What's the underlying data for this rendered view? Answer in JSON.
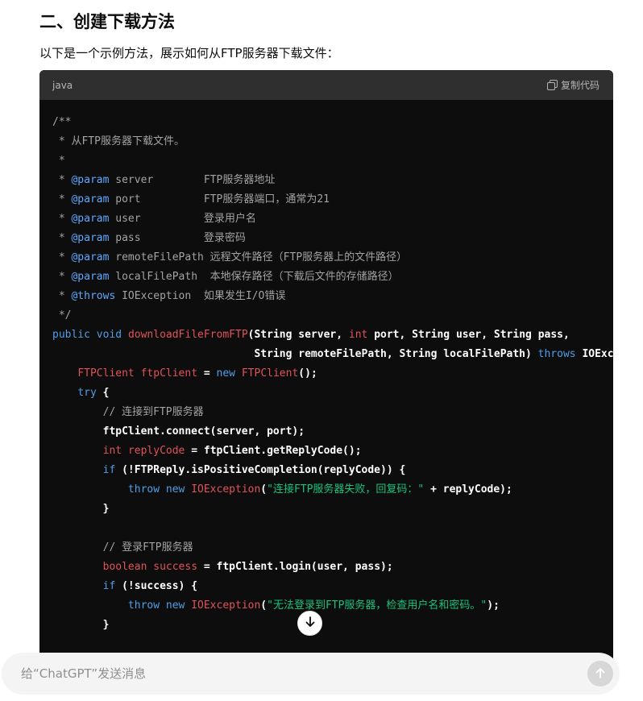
{
  "content": {
    "heading": "二、创建下载方法",
    "intro": "以下是一个示例方法，展示如何从FTP服务器下载文件："
  },
  "code_block": {
    "language": "java",
    "copy_label": "复制代码",
    "lines": [
      [
        {
          "t": "/**",
          "c": "comment"
        }
      ],
      [
        {
          "t": " * 从FTP服务器下载文件。",
          "c": "comment"
        }
      ],
      [
        {
          "t": " *",
          "c": "comment"
        }
      ],
      [
        {
          "t": " * ",
          "c": "comment"
        },
        {
          "t": "@param",
          "c": "tag"
        },
        {
          "t": " server        FTP服务器地址",
          "c": "comment"
        }
      ],
      [
        {
          "t": " * ",
          "c": "comment"
        },
        {
          "t": "@param",
          "c": "tag"
        },
        {
          "t": " port          FTP服务器端口，通常为21",
          "c": "comment"
        }
      ],
      [
        {
          "t": " * ",
          "c": "comment"
        },
        {
          "t": "@param",
          "c": "tag"
        },
        {
          "t": " user          登录用户名",
          "c": "comment"
        }
      ],
      [
        {
          "t": " * ",
          "c": "comment"
        },
        {
          "t": "@param",
          "c": "tag"
        },
        {
          "t": " pass          登录密码",
          "c": "comment"
        }
      ],
      [
        {
          "t": " * ",
          "c": "comment"
        },
        {
          "t": "@param",
          "c": "tag"
        },
        {
          "t": " remoteFilePath 远程文件路径（FTP服务器上的文件路径）",
          "c": "comment"
        }
      ],
      [
        {
          "t": " * ",
          "c": "comment"
        },
        {
          "t": "@param",
          "c": "tag"
        },
        {
          "t": " localFilePath  本地保存路径（下载后文件的存储路径）",
          "c": "comment"
        }
      ],
      [
        {
          "t": " * ",
          "c": "comment"
        },
        {
          "t": "@throws",
          "c": "tag"
        },
        {
          "t": " IOException  如果发生I/O错误",
          "c": "comment"
        }
      ],
      [
        {
          "t": " */",
          "c": "comment"
        }
      ],
      [
        {
          "t": "public",
          "c": "keyword"
        },
        {
          "t": " ",
          "c": "plain"
        },
        {
          "t": "void",
          "c": "keyword"
        },
        {
          "t": " ",
          "c": "plain"
        },
        {
          "t": "downloadFileFromFTP",
          "c": "func"
        },
        {
          "t": "(String server, ",
          "c": "plain"
        },
        {
          "t": "int",
          "c": "type"
        },
        {
          "t": " port, String user, String pass,",
          "c": "plain"
        }
      ],
      [
        {
          "t": "                                String remoteFilePath, String localFilePath) ",
          "c": "plain"
        },
        {
          "t": "throws",
          "c": "keyword"
        },
        {
          "t": " IOException {",
          "c": "plain"
        }
      ],
      [
        {
          "t": "    ",
          "c": "plain"
        },
        {
          "t": "FTPClient",
          "c": "type"
        },
        {
          "t": " ",
          "c": "plain"
        },
        {
          "t": "ftpClient",
          "c": "type"
        },
        {
          "t": " = ",
          "c": "plain"
        },
        {
          "t": "new",
          "c": "keyword"
        },
        {
          "t": " ",
          "c": "plain"
        },
        {
          "t": "FTPClient",
          "c": "type"
        },
        {
          "t": "();",
          "c": "plain"
        }
      ],
      [
        {
          "t": "    ",
          "c": "plain"
        },
        {
          "t": "try",
          "c": "keyword"
        },
        {
          "t": " {",
          "c": "plain"
        }
      ],
      [
        {
          "t": "        // 连接到FTP服务器",
          "c": "comment"
        }
      ],
      [
        {
          "t": "        ftpClient.connect(server, port);",
          "c": "plain"
        }
      ],
      [
        {
          "t": "        ",
          "c": "plain"
        },
        {
          "t": "int",
          "c": "type"
        },
        {
          "t": " ",
          "c": "plain"
        },
        {
          "t": "replyCode",
          "c": "type"
        },
        {
          "t": " = ftpClient.getReplyCode();",
          "c": "plain"
        }
      ],
      [
        {
          "t": "        ",
          "c": "plain"
        },
        {
          "t": "if",
          "c": "keyword"
        },
        {
          "t": " (!FTPReply.isPositiveCompletion(replyCode)) {",
          "c": "plain"
        }
      ],
      [
        {
          "t": "            ",
          "c": "plain"
        },
        {
          "t": "throw",
          "c": "keyword"
        },
        {
          "t": " ",
          "c": "plain"
        },
        {
          "t": "new",
          "c": "keyword"
        },
        {
          "t": " ",
          "c": "plain"
        },
        {
          "t": "IOException",
          "c": "type"
        },
        {
          "t": "(",
          "c": "plain"
        },
        {
          "t": "\"连接FTP服务器失败，回复码：\"",
          "c": "string"
        },
        {
          "t": " + replyCode);",
          "c": "plain"
        }
      ],
      [
        {
          "t": "        }",
          "c": "plain"
        }
      ],
      [
        {
          "t": "",
          "c": "plain"
        }
      ],
      [
        {
          "t": "        // 登录FTP服务器",
          "c": "comment"
        }
      ],
      [
        {
          "t": "        ",
          "c": "plain"
        },
        {
          "t": "boolean",
          "c": "type"
        },
        {
          "t": " ",
          "c": "plain"
        },
        {
          "t": "success",
          "c": "type"
        },
        {
          "t": " = ftpClient.login(user, pass);",
          "c": "plain"
        }
      ],
      [
        {
          "t": "        ",
          "c": "plain"
        },
        {
          "t": "if",
          "c": "keyword"
        },
        {
          "t": " (!success) {",
          "c": "plain"
        }
      ],
      [
        {
          "t": "            ",
          "c": "plain"
        },
        {
          "t": "throw",
          "c": "keyword"
        },
        {
          "t": " ",
          "c": "plain"
        },
        {
          "t": "new",
          "c": "keyword"
        },
        {
          "t": " ",
          "c": "plain"
        },
        {
          "t": "IOException",
          "c": "type"
        },
        {
          "t": "(",
          "c": "plain"
        },
        {
          "t": "\"无法登录到FTP服务器，检查用户名和密码。\"",
          "c": "string"
        },
        {
          "t": ");",
          "c": "plain"
        }
      ],
      [
        {
          "t": "        }",
          "c": "plain"
        }
      ]
    ]
  },
  "composer": {
    "placeholder": "给“ChatGPT”发送消息"
  },
  "icons": {
    "copy": "copy-icon",
    "scroll_down": "arrow-down-icon",
    "send": "arrow-up-icon"
  }
}
